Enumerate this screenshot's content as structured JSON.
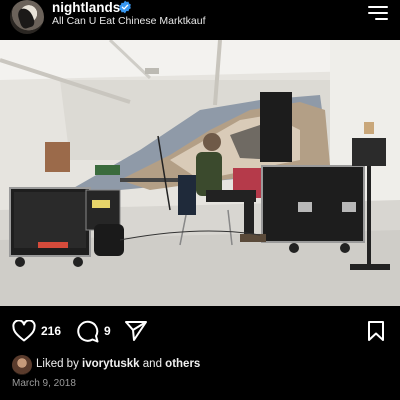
{
  "post": {
    "username": "nightlands",
    "subtitle": "All Can U Eat Chinese Marktkauf",
    "verified": true,
    "likes": "216",
    "comments": "9",
    "liked_prefix": "Liked by",
    "liked_user": "ivorytuskk",
    "liked_and": "and",
    "liked_others": "others",
    "date": "March 9, 2018"
  },
  "icons": {
    "verified": "verified-badge-icon",
    "menu": "hamburger-menu-icon",
    "like": "heart-icon",
    "comment": "comment-bubble-icon",
    "share": "send-arrow-icon",
    "save": "bookmark-icon"
  },
  "colors": {
    "background": "#000000",
    "verified": "#3897f0",
    "text": "#ffffff",
    "muted": "#9a9a9a"
  }
}
